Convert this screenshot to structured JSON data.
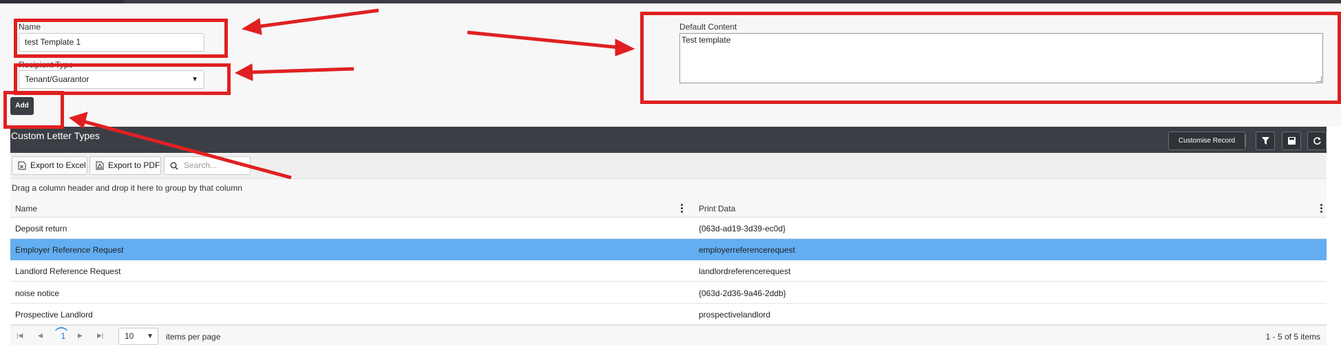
{
  "form": {
    "name_label": "Name",
    "name_value": "test Template 1",
    "recipient_label": "Recipient Type",
    "recipient_value": "Tenant/Guarantor",
    "default_content_label": "Default Content",
    "default_content_value": "Test template",
    "add_label": "Add"
  },
  "grid": {
    "title": "Custom Letter Types",
    "customise_label": "Customise Record",
    "export_excel_label": "Export to Excel",
    "export_pdf_label": "Export to PDF",
    "search_placeholder": "Search...",
    "group_hint": "Drag a column header and drop it here to group by that column",
    "columns": [
      "Name",
      "Print Data"
    ],
    "rows": [
      {
        "name": "Deposit return",
        "print_data": "{063d-ad19-3d39-ec0d}",
        "selected": false
      },
      {
        "name": "Employer Reference Request",
        "print_data": "employerreferencerequest",
        "selected": true
      },
      {
        "name": "Landlord Reference Request",
        "print_data": "landlordreferencerequest",
        "selected": false
      },
      {
        "name": "noise notice",
        "print_data": "{063d-2d36-9a46-2ddb}",
        "selected": false
      },
      {
        "name": "Prospective Landlord",
        "print_data": "prospectivelandlord",
        "selected": false
      }
    ]
  },
  "pager": {
    "current_page": "1",
    "page_size": "10",
    "page_size_label": "items per page",
    "info": "1 - 5 of 5 items"
  },
  "icons": {
    "filter": "filter-icon",
    "save": "save-icon",
    "refresh": "refresh-icon",
    "excel": "excel-file-icon",
    "pdf": "pdf-file-icon",
    "search": "search-icon"
  },
  "colors": {
    "header_bg": "#3b3f45",
    "selected_row": "#63adf2",
    "annotation_red": "#e02020"
  }
}
